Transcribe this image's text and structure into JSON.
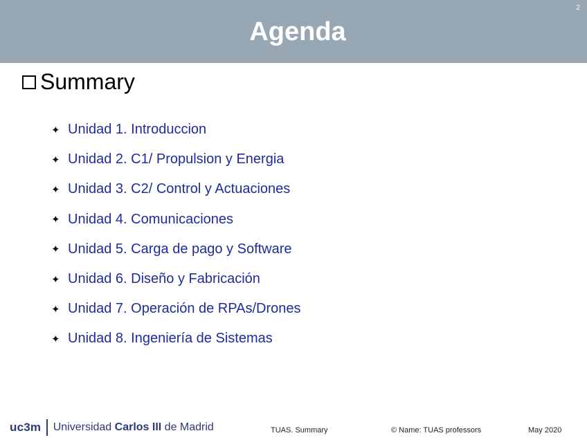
{
  "slide": {
    "page_number": "2",
    "title": "Agenda",
    "summary_label": "Summary"
  },
  "units": [
    "Unidad 1. Introduccion",
    "Unidad 2. C1/ Propulsion y Energia",
    "Unidad 3. C2/ Control y Actuaciones",
    "Unidad 4. Comunicaciones",
    "Unidad 5. Carga de pago y Software",
    "Unidad 6. Diseño y Fabricación",
    "Unidad 7. Operación de RPAs/Drones",
    "Unidad 8. Ingeniería de Sistemas"
  ],
  "footer": {
    "logo_uc3m": "uc3m",
    "logo_text_regular": "Universidad ",
    "logo_text_bold": "Carlos III",
    "logo_text_end": " de Madrid",
    "center": "TUAS. Summary",
    "author": "© Name: TUAS professors",
    "date": "May 2020"
  },
  "colors": {
    "header_bg": "#97a7b4",
    "unit_text": "#1f2b9c"
  }
}
